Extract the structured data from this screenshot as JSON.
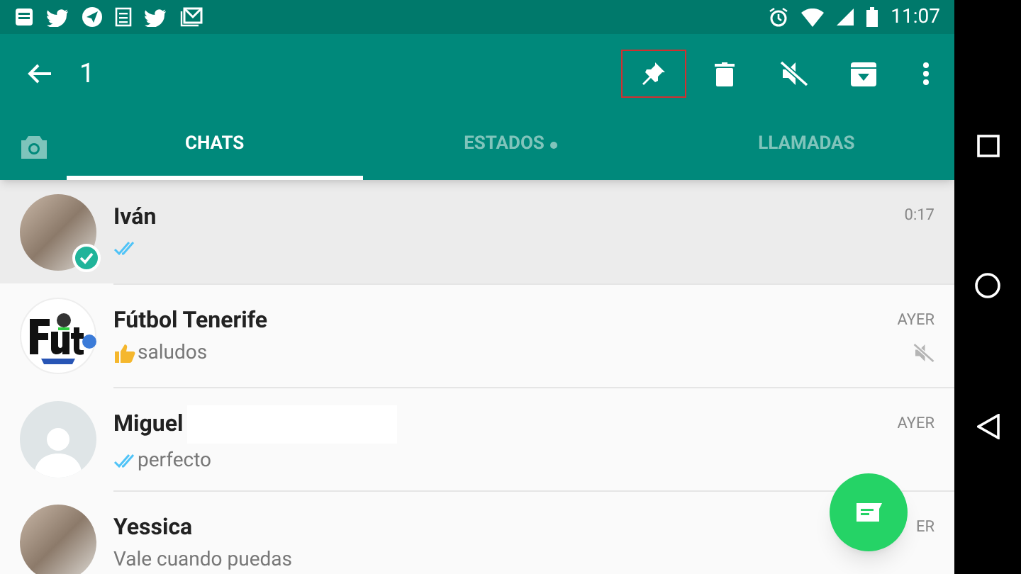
{
  "status_bar": {
    "time": "11:07"
  },
  "action_bar": {
    "selected_count": "1"
  },
  "tabs": [
    {
      "label": "CHATS",
      "selected": true,
      "dot": false
    },
    {
      "label": "ESTADOS",
      "selected": false,
      "dot": true
    },
    {
      "label": "LLAMADAS",
      "selected": false,
      "dot": false
    }
  ],
  "chats": [
    {
      "name": "Iván",
      "time": "0:17",
      "kind": "photo",
      "read": true,
      "thumbs_up": false,
      "selected": true,
      "muted": false,
      "redacted": false
    },
    {
      "name": "Fútbol Tenerife",
      "time": "AYER",
      "preview": "saludos",
      "kind": "logo",
      "read": false,
      "thumbs_up": true,
      "selected": false,
      "muted": true,
      "redacted": false
    },
    {
      "name": "Miguel",
      "time": "AYER",
      "preview": "perfecto",
      "kind": "default",
      "read": true,
      "thumbs_up": false,
      "selected": false,
      "muted": false,
      "redacted": true
    },
    {
      "name": "Yessica",
      "time": "ER",
      "preview": "Vale cuando puedas",
      "kind": "photo",
      "read": false,
      "thumbs_up": false,
      "selected": false,
      "muted": false,
      "redacted": false
    }
  ]
}
